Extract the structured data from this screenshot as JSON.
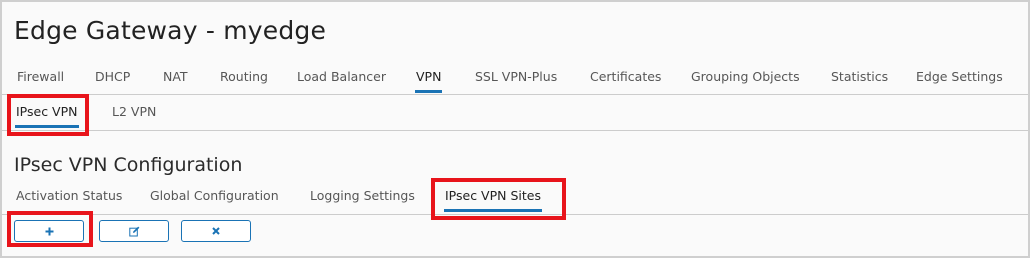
{
  "header": {
    "title": "Edge Gateway - myedge"
  },
  "main_tabs": [
    {
      "label": "Firewall"
    },
    {
      "label": "DHCP"
    },
    {
      "label": "NAT"
    },
    {
      "label": "Routing"
    },
    {
      "label": "Load Balancer"
    },
    {
      "label": "VPN",
      "active": true
    },
    {
      "label": "SSL VPN-Plus"
    },
    {
      "label": "Certificates"
    },
    {
      "label": "Grouping Objects"
    },
    {
      "label": "Statistics"
    },
    {
      "label": "Edge Settings"
    }
  ],
  "vpn_tabs": [
    {
      "label": "IPsec VPN",
      "active": true
    },
    {
      "label": "L2 VPN"
    }
  ],
  "config": {
    "title": "IPsec VPN Configuration",
    "tabs": [
      {
        "label": "Activation Status"
      },
      {
        "label": "Global Configuration"
      },
      {
        "label": "Logging Settings"
      },
      {
        "label": "IPsec VPN Sites",
        "active": true
      }
    ]
  },
  "toolbar": {
    "add_icon": "plus-icon",
    "edit_icon": "edit-icon",
    "delete_icon": "close-icon"
  },
  "colors": {
    "accent": "#1a73b5",
    "highlight": "#e8141b"
  }
}
